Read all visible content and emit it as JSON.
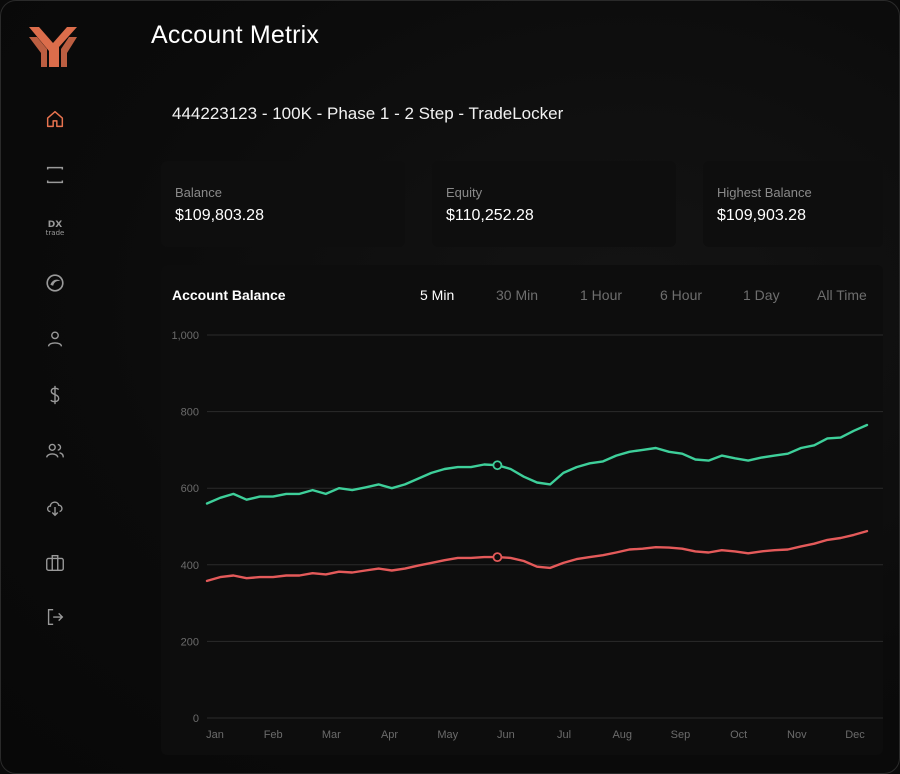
{
  "app": {
    "title": "Account Metrix"
  },
  "account": {
    "name": "444223123 - 100K - Phase 1 - 2 Step - TradeLocker"
  },
  "sidebar": {
    "items": [
      {
        "name": "home",
        "icon": "home-icon",
        "active": true
      },
      {
        "name": "brackets",
        "icon": "brackets-icon"
      },
      {
        "name": "dxtrade",
        "icon": "dxtrade-icon",
        "text": "DX",
        "subtext": "trade"
      },
      {
        "name": "platform",
        "icon": "swirl-icon"
      },
      {
        "name": "user",
        "icon": "user-icon"
      },
      {
        "name": "dollar",
        "icon": "dollar-icon"
      },
      {
        "name": "users",
        "icon": "users-icon"
      },
      {
        "name": "download",
        "icon": "cloud-download-icon"
      },
      {
        "name": "briefcase",
        "icon": "briefcase-icon"
      },
      {
        "name": "logout",
        "icon": "logout-icon"
      }
    ]
  },
  "stats": [
    {
      "label": "Balance",
      "value": "$109,803.28"
    },
    {
      "label": "Equity",
      "value": "$110,252.28"
    },
    {
      "label": "Highest Balance",
      "value": "$109,903.28"
    }
  ],
  "chart_header": {
    "title": "Account Balance",
    "tabs": [
      "5 Min",
      "30 Min",
      "1 Hour",
      "6 Hour",
      "1 Day",
      "All Time"
    ],
    "active_tab": "5 Min"
  },
  "colors": {
    "accent": "#e8734f",
    "green": "#3ecf9a",
    "red": "#e45a5a",
    "grid": "#2b2b2b"
  },
  "chart_data": {
    "type": "line",
    "categories": [
      "Jan",
      "Feb",
      "Mar",
      "Apr",
      "May",
      "Jun",
      "Jul",
      "Aug",
      "Sep",
      "Oct",
      "Nov",
      "Dec"
    ],
    "ylim": [
      0,
      1000
    ],
    "yticks": [
      "0",
      "200",
      "400",
      "600",
      "800",
      "1,000"
    ],
    "series": [
      {
        "color": "#3ecf9a",
        "values": [
          560,
          575,
          585,
          570,
          578,
          578,
          585,
          585,
          595,
          585,
          600,
          595,
          602,
          610,
          600,
          610,
          625,
          640,
          650,
          655,
          655,
          662,
          660,
          650,
          630,
          615,
          610,
          640,
          655,
          665,
          670,
          685,
          695,
          700,
          705,
          695,
          690,
          675,
          672,
          685,
          678,
          672,
          680,
          685,
          690,
          705,
          712,
          730,
          732,
          750,
          765
        ],
        "marker_index": 22
      },
      {
        "color": "#e45a5a",
        "values": [
          358,
          368,
          372,
          365,
          368,
          368,
          372,
          372,
          378,
          375,
          382,
          380,
          385,
          390,
          385,
          390,
          398,
          405,
          412,
          418,
          418,
          420,
          420,
          418,
          410,
          395,
          392,
          405,
          415,
          420,
          425,
          432,
          440,
          442,
          446,
          445,
          442,
          435,
          432,
          438,
          435,
          430,
          435,
          438,
          440,
          448,
          455,
          465,
          470,
          478,
          488
        ],
        "marker_index": 22
      }
    ]
  }
}
